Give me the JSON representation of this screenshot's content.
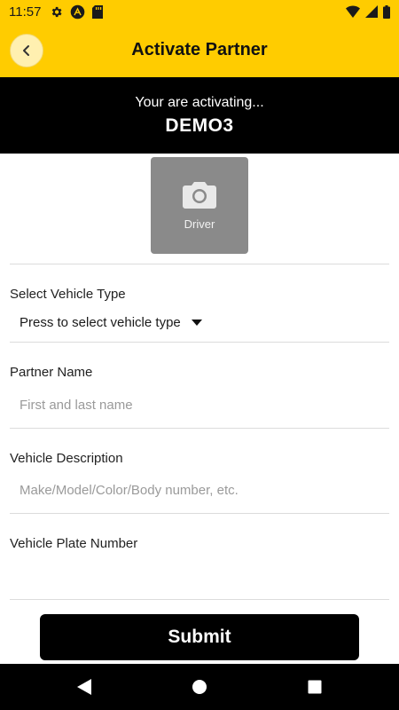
{
  "status_bar": {
    "time": "11:57",
    "left_icons": [
      "settings-icon",
      "app-a-icon",
      "sd-card-icon"
    ],
    "right_icons": [
      "wifi-icon",
      "signal-icon",
      "battery-icon"
    ]
  },
  "app_bar": {
    "title": "Activate Partner",
    "back_icon": "chevron-left-icon",
    "color": "#FFCC00"
  },
  "banner": {
    "subtitle": "Your are activating...",
    "code": "DEMO3"
  },
  "photo": {
    "icon": "camera-icon",
    "label": "Driver"
  },
  "form": {
    "vehicle_type": {
      "label": "Select Vehicle Type",
      "value": "Press to select vehicle type"
    },
    "partner_name": {
      "label": "Partner Name",
      "placeholder": "First and last name"
    },
    "vehicle_description": {
      "label": "Vehicle Description",
      "placeholder": "Make/Model/Color/Body number, etc."
    },
    "plate_number": {
      "label": "Vehicle Plate Number",
      "placeholder": ""
    }
  },
  "submit": {
    "label": "Submit"
  },
  "nav_bar": {
    "items": [
      "back-triangle-icon",
      "home-circle-icon",
      "recents-square-icon"
    ]
  }
}
